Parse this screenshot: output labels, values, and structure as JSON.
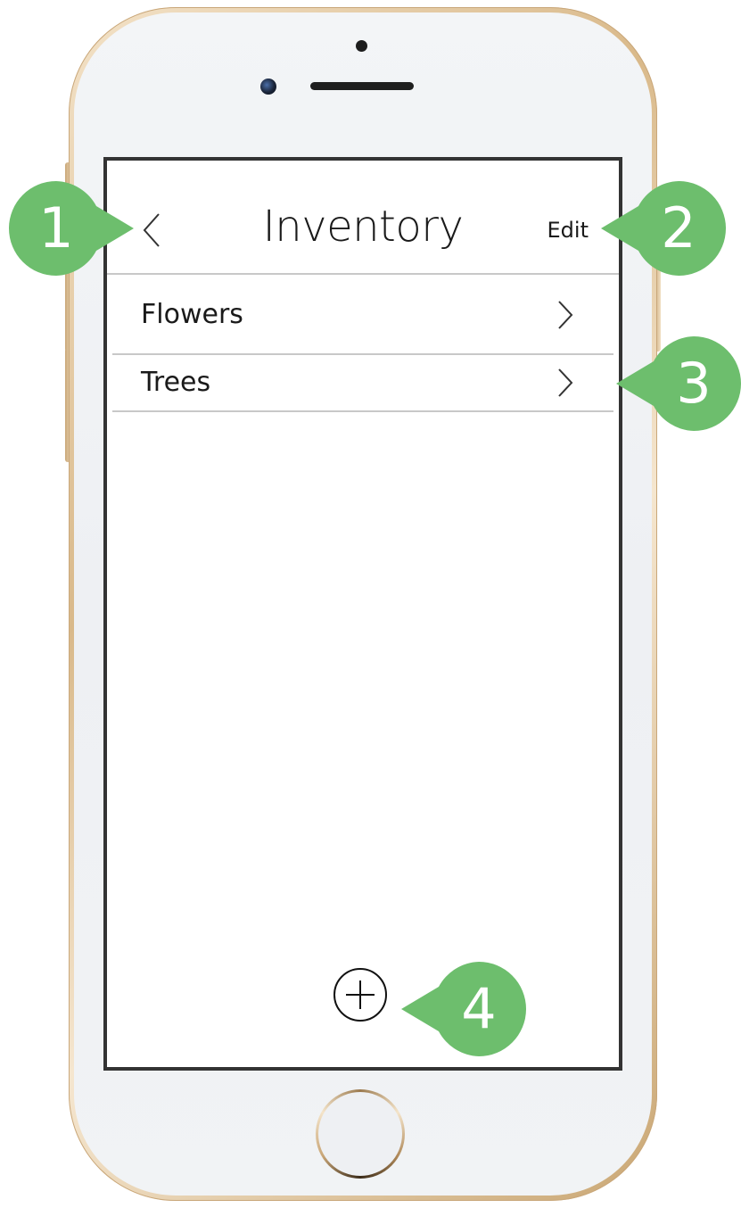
{
  "header": {
    "back_icon": "chevron-left-icon",
    "title": "Inventory",
    "edit_label": "Edit"
  },
  "list": {
    "items": [
      {
        "label": "Flowers",
        "icon": "chevron-right-icon"
      },
      {
        "label": "Trees",
        "icon": "chevron-right-icon"
      }
    ]
  },
  "footer": {
    "add_icon": "plus-circle-icon"
  },
  "callouts": [
    {
      "number": "1"
    },
    {
      "number": "2"
    },
    {
      "number": "3"
    },
    {
      "number": "4"
    }
  ],
  "colors": {
    "callout": "#6dbe6d",
    "screen_border": "#333333",
    "divider": "#c8c8c8",
    "frame_gold": "#d9b98a"
  }
}
